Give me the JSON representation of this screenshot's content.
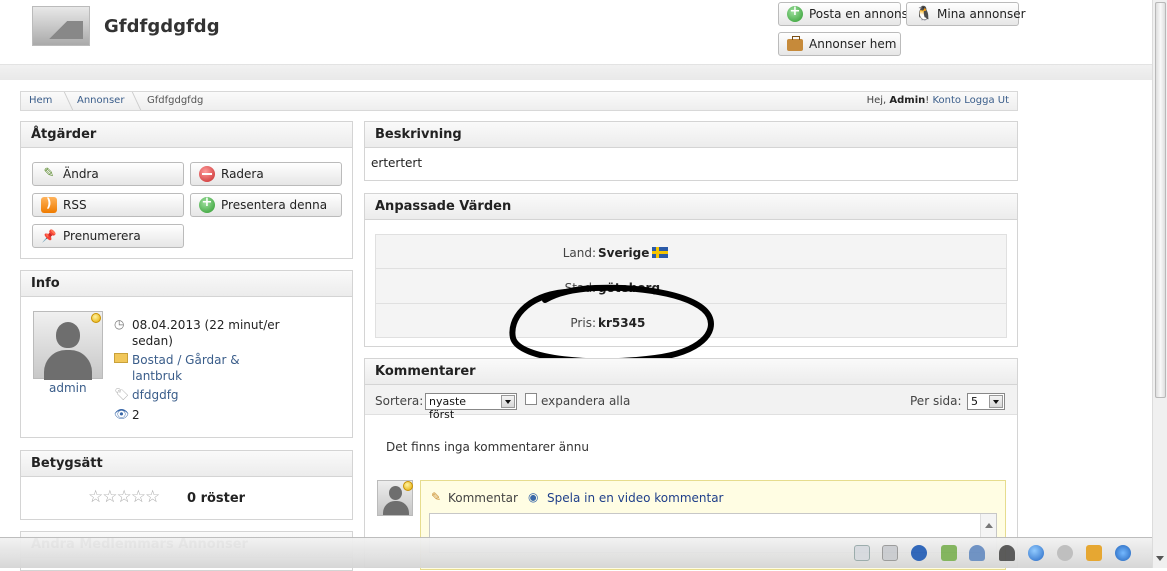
{
  "header": {
    "site_title": "Gfdfgdgfdg",
    "post_ad_label": "Posta en annons",
    "my_ads_label": "Mina annonser",
    "ads_home_label": "Annonser hem"
  },
  "breadcrumb": {
    "items": [
      "Hem",
      "Annonser",
      "Gfdfgdgfdg"
    ],
    "greeting": "Hej,",
    "username": "Admin",
    "exclaim": "!",
    "account_link": "Konto",
    "logout_link": "Logga Ut"
  },
  "actions": {
    "title": "Åtgärder",
    "edit_label": "Ändra",
    "delete_label": "Radera",
    "rss_label": "RSS",
    "feature_label": "Presentera denna",
    "subscribe_label": "Prenumerera"
  },
  "info": {
    "title": "Info",
    "date_line1": "08.04.2013 (22 minut/er",
    "date_line2": "sedan)",
    "category_line1": "Bostad / Gårdar &",
    "category_line2": "lantbruk",
    "tag": "dfdgdfg",
    "views": "2",
    "author": "admin"
  },
  "rating": {
    "title": "Betygsätt",
    "stars": "☆☆☆☆☆",
    "votes": "0 röster"
  },
  "other_ads_title": "Andra Medlemmars Annonser",
  "description": {
    "title": "Beskrivning",
    "text": "ertertert"
  },
  "custom_values": {
    "title": "Anpassade Värden",
    "rows": [
      {
        "label": "Land:",
        "value": "Sverige"
      },
      {
        "label": "Stad:",
        "value": "göteborg"
      },
      {
        "label": "Pris:",
        "value": "kr5345"
      }
    ]
  },
  "comments": {
    "title": "Kommentarer",
    "sort_label": "Sortera:",
    "sort_value": "nyaste först",
    "expand_label": "expandera alla",
    "per_page_label": "Per sida:",
    "per_page_value": "5",
    "empty_text": "Det finns inga kommentarer ännu",
    "comment_tab": "Kommentar",
    "video_tab": "Spela in en video kommentar"
  },
  "colors": {
    "link": "#3a5d8a",
    "comment_bg": "#fffde3",
    "comment_border": "#e6dc8e"
  }
}
